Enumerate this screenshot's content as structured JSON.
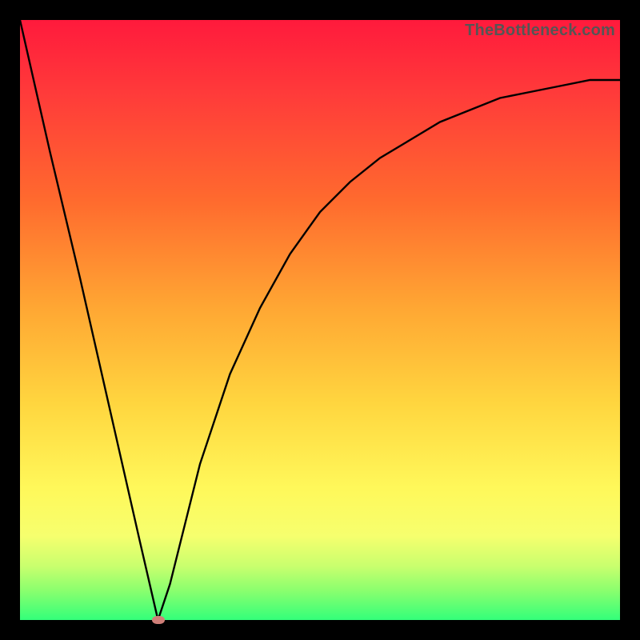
{
  "watermark": "TheBottleneck.com",
  "colors": {
    "frame": "#000000",
    "curve": "#000000",
    "marker": "#cf7e78",
    "gradient_top": "#ff1a3c",
    "gradient_bottom": "#33ff7a"
  },
  "chart_data": {
    "type": "line",
    "title": "",
    "xlabel": "",
    "ylabel": "",
    "xlim": [
      0,
      100
    ],
    "ylim": [
      0,
      100
    ],
    "grid": false,
    "legend": false,
    "annotations": [
      {
        "label": "watermark",
        "text": "TheBottleneck.com",
        "position": "top-right"
      }
    ],
    "series": [
      {
        "name": "bottleneck-curve",
        "x": [
          0,
          5,
          10,
          15,
          20,
          23,
          25,
          28,
          30,
          35,
          40,
          45,
          50,
          55,
          60,
          65,
          70,
          75,
          80,
          85,
          90,
          95,
          100
        ],
        "y": [
          100,
          78,
          57,
          35,
          13,
          0,
          6,
          18,
          26,
          41,
          52,
          61,
          68,
          73,
          77,
          80,
          83,
          85,
          87,
          88,
          89,
          90,
          90
        ]
      }
    ],
    "markers": [
      {
        "name": "minimum",
        "x": 23,
        "y": 0
      }
    ]
  }
}
